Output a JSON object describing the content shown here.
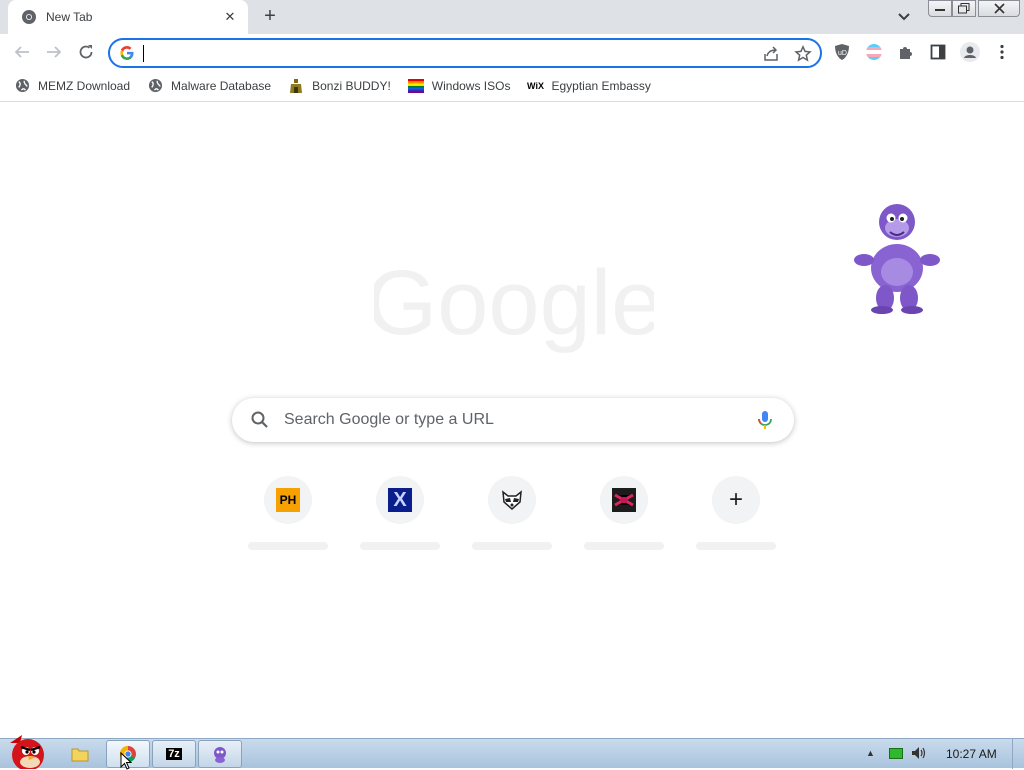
{
  "tab": {
    "title": "New Tab",
    "favicon": "chrome-icon"
  },
  "omnibox": {
    "value": "",
    "placeholder": ""
  },
  "bookmarks": [
    {
      "label": "MEMZ Download",
      "icon": "globe-icon"
    },
    {
      "label": "Malware Database",
      "icon": "globe-icon"
    },
    {
      "label": "Bonzi BUDDY!",
      "icon": "bonzi-bm-icon"
    },
    {
      "label": "Windows ISOs",
      "icon": "rainbow-flag-icon"
    },
    {
      "label": "Egyptian Embassy",
      "icon": "wix-icon"
    }
  ],
  "wix_text": "WiX",
  "newtab": {
    "logo_text": "Google",
    "search_placeholder": "Search Google or type a URL",
    "shortcuts": [
      {
        "icon": "ph-icon",
        "text": "PH"
      },
      {
        "icon": "x-icon",
        "text": "X"
      },
      {
        "icon": "raccoon-icon",
        "text": ""
      },
      {
        "icon": "red-logo-icon",
        "text": ""
      },
      {
        "icon": "add-shortcut-icon",
        "text": "+"
      }
    ]
  },
  "taskbar": {
    "clock": "10:27 AM",
    "items": [
      "folder-icon",
      "chrome-icon",
      "7zip-icon",
      "bonzi-icon"
    ],
    "zip_text": "7z"
  },
  "colors": {
    "accent": "#1a73e8",
    "tabstrip": "#dee1e6",
    "taskbar": "#b8cfe6"
  }
}
